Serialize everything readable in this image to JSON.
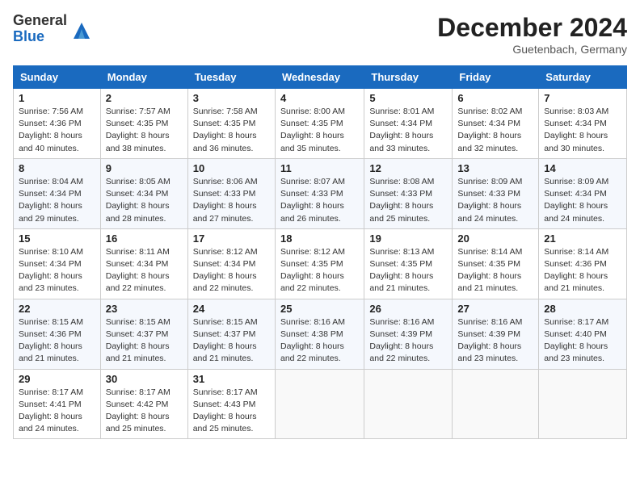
{
  "logo": {
    "general": "General",
    "blue": "Blue"
  },
  "title": "December 2024",
  "subtitle": "Guetenbach, Germany",
  "days_of_week": [
    "Sunday",
    "Monday",
    "Tuesday",
    "Wednesday",
    "Thursday",
    "Friday",
    "Saturday"
  ],
  "weeks": [
    [
      {
        "day": "1",
        "info": "Sunrise: 7:56 AM\nSunset: 4:36 PM\nDaylight: 8 hours\nand 40 minutes."
      },
      {
        "day": "2",
        "info": "Sunrise: 7:57 AM\nSunset: 4:35 PM\nDaylight: 8 hours\nand 38 minutes."
      },
      {
        "day": "3",
        "info": "Sunrise: 7:58 AM\nSunset: 4:35 PM\nDaylight: 8 hours\nand 36 minutes."
      },
      {
        "day": "4",
        "info": "Sunrise: 8:00 AM\nSunset: 4:35 PM\nDaylight: 8 hours\nand 35 minutes."
      },
      {
        "day": "5",
        "info": "Sunrise: 8:01 AM\nSunset: 4:34 PM\nDaylight: 8 hours\nand 33 minutes."
      },
      {
        "day": "6",
        "info": "Sunrise: 8:02 AM\nSunset: 4:34 PM\nDaylight: 8 hours\nand 32 minutes."
      },
      {
        "day": "7",
        "info": "Sunrise: 8:03 AM\nSunset: 4:34 PM\nDaylight: 8 hours\nand 30 minutes."
      }
    ],
    [
      {
        "day": "8",
        "info": "Sunrise: 8:04 AM\nSunset: 4:34 PM\nDaylight: 8 hours\nand 29 minutes."
      },
      {
        "day": "9",
        "info": "Sunrise: 8:05 AM\nSunset: 4:34 PM\nDaylight: 8 hours\nand 28 minutes."
      },
      {
        "day": "10",
        "info": "Sunrise: 8:06 AM\nSunset: 4:33 PM\nDaylight: 8 hours\nand 27 minutes."
      },
      {
        "day": "11",
        "info": "Sunrise: 8:07 AM\nSunset: 4:33 PM\nDaylight: 8 hours\nand 26 minutes."
      },
      {
        "day": "12",
        "info": "Sunrise: 8:08 AM\nSunset: 4:33 PM\nDaylight: 8 hours\nand 25 minutes."
      },
      {
        "day": "13",
        "info": "Sunrise: 8:09 AM\nSunset: 4:33 PM\nDaylight: 8 hours\nand 24 minutes."
      },
      {
        "day": "14",
        "info": "Sunrise: 8:09 AM\nSunset: 4:34 PM\nDaylight: 8 hours\nand 24 minutes."
      }
    ],
    [
      {
        "day": "15",
        "info": "Sunrise: 8:10 AM\nSunset: 4:34 PM\nDaylight: 8 hours\nand 23 minutes."
      },
      {
        "day": "16",
        "info": "Sunrise: 8:11 AM\nSunset: 4:34 PM\nDaylight: 8 hours\nand 22 minutes."
      },
      {
        "day": "17",
        "info": "Sunrise: 8:12 AM\nSunset: 4:34 PM\nDaylight: 8 hours\nand 22 minutes."
      },
      {
        "day": "18",
        "info": "Sunrise: 8:12 AM\nSunset: 4:35 PM\nDaylight: 8 hours\nand 22 minutes."
      },
      {
        "day": "19",
        "info": "Sunrise: 8:13 AM\nSunset: 4:35 PM\nDaylight: 8 hours\nand 21 minutes."
      },
      {
        "day": "20",
        "info": "Sunrise: 8:14 AM\nSunset: 4:35 PM\nDaylight: 8 hours\nand 21 minutes."
      },
      {
        "day": "21",
        "info": "Sunrise: 8:14 AM\nSunset: 4:36 PM\nDaylight: 8 hours\nand 21 minutes."
      }
    ],
    [
      {
        "day": "22",
        "info": "Sunrise: 8:15 AM\nSunset: 4:36 PM\nDaylight: 8 hours\nand 21 minutes."
      },
      {
        "day": "23",
        "info": "Sunrise: 8:15 AM\nSunset: 4:37 PM\nDaylight: 8 hours\nand 21 minutes."
      },
      {
        "day": "24",
        "info": "Sunrise: 8:15 AM\nSunset: 4:37 PM\nDaylight: 8 hours\nand 21 minutes."
      },
      {
        "day": "25",
        "info": "Sunrise: 8:16 AM\nSunset: 4:38 PM\nDaylight: 8 hours\nand 22 minutes."
      },
      {
        "day": "26",
        "info": "Sunrise: 8:16 AM\nSunset: 4:39 PM\nDaylight: 8 hours\nand 22 minutes."
      },
      {
        "day": "27",
        "info": "Sunrise: 8:16 AM\nSunset: 4:39 PM\nDaylight: 8 hours\nand 23 minutes."
      },
      {
        "day": "28",
        "info": "Sunrise: 8:17 AM\nSunset: 4:40 PM\nDaylight: 8 hours\nand 23 minutes."
      }
    ],
    [
      {
        "day": "29",
        "info": "Sunrise: 8:17 AM\nSunset: 4:41 PM\nDaylight: 8 hours\nand 24 minutes."
      },
      {
        "day": "30",
        "info": "Sunrise: 8:17 AM\nSunset: 4:42 PM\nDaylight: 8 hours\nand 25 minutes."
      },
      {
        "day": "31",
        "info": "Sunrise: 8:17 AM\nSunset: 4:43 PM\nDaylight: 8 hours\nand 25 minutes."
      },
      null,
      null,
      null,
      null
    ]
  ]
}
